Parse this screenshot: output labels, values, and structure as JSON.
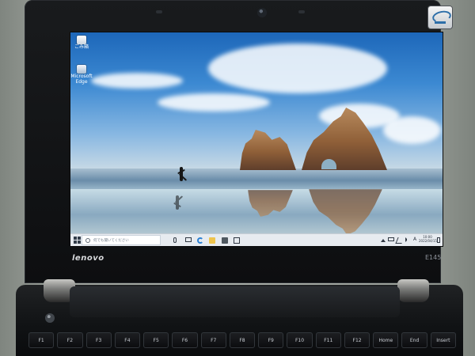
{
  "desktop": {
    "icons": [
      {
        "label": "ごみ箱",
        "icon": "recycle-bin-icon"
      },
      {
        "label": "Microsoft Edge",
        "icon": "edge-icon"
      }
    ]
  },
  "taskbar": {
    "search_placeholder": "何でも聞いてください",
    "ime_label": "A",
    "time": "10:00",
    "date": "2022/04/15"
  },
  "laptop": {
    "brand": "lenovo",
    "model": "E145"
  },
  "keyboard": {
    "keys": [
      "F1",
      "F2",
      "F3",
      "F4",
      "F5",
      "F6",
      "F7",
      "F8",
      "F9",
      "F10",
      "F11",
      "F12",
      "Home",
      "End",
      "Insert"
    ]
  },
  "colors": {
    "bezel": "#111214",
    "screen_sky": "#3c89d2",
    "taskbar": "#e7ebf0"
  }
}
